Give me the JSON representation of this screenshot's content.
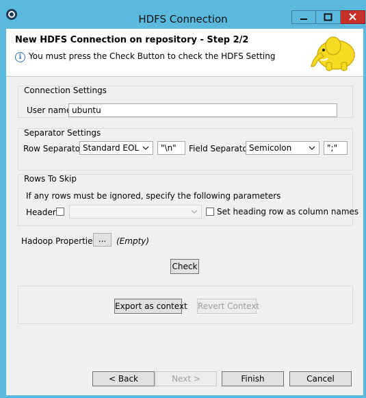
{
  "window": {
    "title": "HDFS Connection"
  },
  "header": {
    "title": "New HDFS Connection on repository - Step 2/2",
    "message": "You must press the Check Button to check the HDFS Setting"
  },
  "connection_settings": {
    "group_label": "Connection Settings",
    "user_name_label": "User name",
    "user_name_value": "ubuntu"
  },
  "separator_settings": {
    "group_label": "Separator Settings",
    "row_separator_label": "Row Separator",
    "row_separator_selected": "Standard EOL",
    "row_separator_value": "\"\\n\"",
    "field_separator_label": "Field Separator",
    "field_separator_selected": "Semicolon",
    "field_separator_value": "\";\""
  },
  "rows_to_skip": {
    "group_label": "Rows To Skip",
    "description": "If any rows must be ignored, specify the following parameters",
    "header_label": "Header",
    "header_checked": false,
    "heading_row_label": "Set heading row as column names",
    "heading_row_checked": false
  },
  "hadoop_properties": {
    "label": "Hadoop Properties",
    "button_label": "...",
    "status": "(Empty)"
  },
  "check_button": "Check",
  "context": {
    "export_label": "Export as context",
    "revert_label": "Revert Context"
  },
  "footer": {
    "back_label": "< Back",
    "next_label": "Next >",
    "finish_label": "Finish",
    "cancel_label": "Cancel"
  },
  "icons": {
    "app": "talend-app-icon",
    "info": "info-icon",
    "logo": "hadoop-elephant-logo",
    "dropdown": "chevron-down-icon"
  },
  "colors": {
    "titlebar": "#5ab9dd",
    "close": "#c7312a",
    "logo_yellow": "#f5dc22"
  }
}
